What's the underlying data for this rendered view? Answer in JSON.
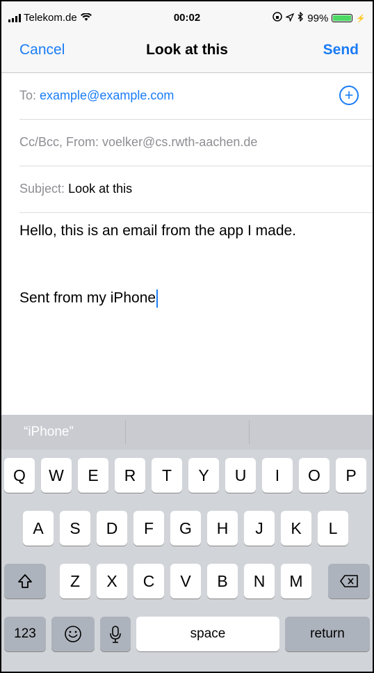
{
  "status": {
    "carrier": "Telekom.de",
    "time": "00:02",
    "battery": "99%"
  },
  "nav": {
    "cancel": "Cancel",
    "title": "Look at this",
    "send": "Send"
  },
  "fields": {
    "to_label": "To:",
    "to_value": "example@example.com",
    "ccbcc": "Cc/Bcc, From:",
    "from_value": "voelker@cs.rwth-aachen.de",
    "subject_label": "Subject:",
    "subject_value": "Look at this"
  },
  "body": {
    "line1": "Hello, this is an email from the app I made.",
    "signature": "Sent from my iPhone"
  },
  "keyboard": {
    "suggestion": "“iPhone”",
    "row1": [
      "Q",
      "W",
      "E",
      "R",
      "T",
      "Y",
      "U",
      "I",
      "O",
      "P"
    ],
    "row2": [
      "A",
      "S",
      "D",
      "F",
      "G",
      "H",
      "J",
      "K",
      "L"
    ],
    "row3": [
      "Z",
      "X",
      "C",
      "V",
      "B",
      "N",
      "M"
    ],
    "numbers": "123",
    "space": "space",
    "return": "return"
  },
  "colors": {
    "accent": "#1a7cf5"
  }
}
